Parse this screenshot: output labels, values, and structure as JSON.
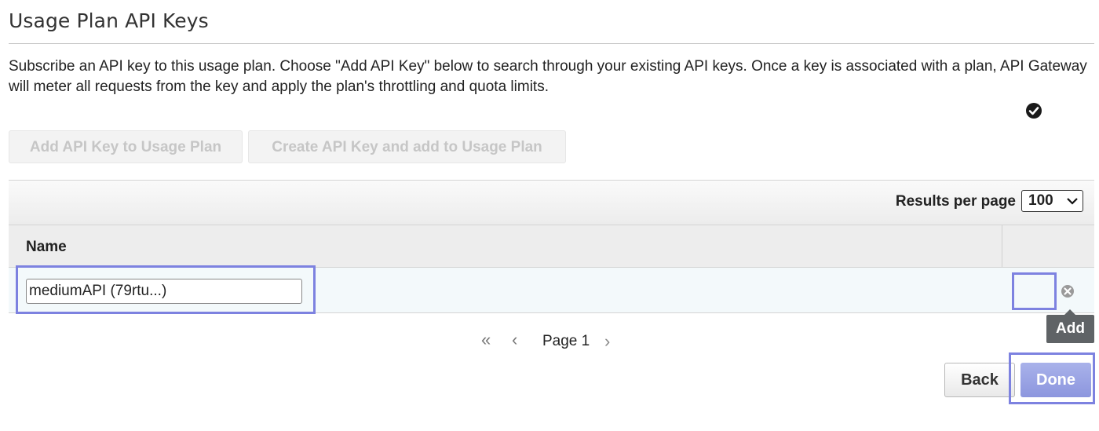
{
  "page": {
    "title": "Usage Plan API Keys",
    "description": "Subscribe an API key to this usage plan. Choose \"Add API Key\" below to search through your existing API keys. Once a key is associated with a plan, API Gateway will meter all requests from the key and apply the plan's throttling and quota limits."
  },
  "actions": {
    "add_key_label": "Add API Key to Usage Plan",
    "create_key_label": "Create API Key and add to Usage Plan"
  },
  "table": {
    "results_per_page_label": "Results per page",
    "results_per_page_value": "100",
    "columns": [
      "Name"
    ],
    "rows": [
      {
        "name_input_value": "mediumAPI (79rtu...)",
        "add_icon": "check-circle-icon",
        "remove_icon": "close-circle-icon"
      }
    ]
  },
  "tooltip": {
    "text": "Add"
  },
  "pagination": {
    "first_glyph": "«",
    "prev_glyph": "‹",
    "page_label": "Page 1",
    "next_glyph": "›"
  },
  "footer": {
    "back_label": "Back",
    "done_label": "Done"
  },
  "colors": {
    "highlight": "#7d82e0",
    "done_button": "#8c96de",
    "tooltip_bg": "#5f6366",
    "row_bg": "#f3f9fb"
  }
}
